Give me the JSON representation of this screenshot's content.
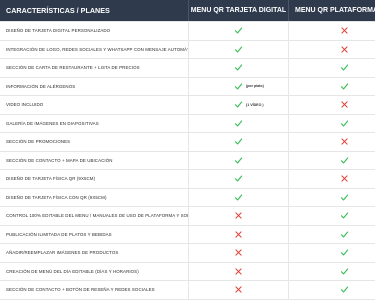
{
  "header": {
    "feature_label": "CARACTERÍSTICAS / PLANES",
    "col1_label": "MENU QR TARJETA DIGITAL",
    "col2_label": "MENU QR PLATAFORMA EDIT"
  },
  "colors": {
    "header_bg": "#2f3b4d",
    "check": "#3cbf5a",
    "cross": "#e0453d"
  },
  "rows": [
    {
      "feature": "DISEÑO DE TARJETA DIGITAL PERSONALIZADO",
      "col1": "check",
      "col1_note": "",
      "col2": "cross"
    },
    {
      "feature": "INTEGRACIÓN DE LOGO, REDES SOCIALES Y WHATSAPP CON MENSAJE AUTOMÁTICO",
      "col1": "check",
      "col1_note": "",
      "col2": "cross"
    },
    {
      "feature": "SECCIÓN DE CARTA DE RESTAURANTE + LISTA DE PRECIOS",
      "col1": "check",
      "col1_note": "",
      "col2": "check"
    },
    {
      "feature": "INFORMACIÓN DE ALÉRGENOS",
      "col1": "check",
      "col1_note": "(por plato)",
      "col2": "check"
    },
    {
      "feature": "VIDEO INCLUIDO",
      "col1": "check",
      "col1_note": "(1 VÍDEO )",
      "col2": "cross"
    },
    {
      "feature": "GALERÍA DE IMÁGENES EN DIAPOSITIVAS",
      "col1": "check",
      "col1_note": "",
      "col2": "check"
    },
    {
      "feature": "SECCIÓN DE PROMOCIONES",
      "col1": "check",
      "col1_note": "",
      "col2": "cross"
    },
    {
      "feature": "SECCIÓN DE CONTACTO + MAPA DE UBICACIÓN",
      "col1": "check",
      "col1_note": "",
      "col2": "check"
    },
    {
      "feature": "DISEÑO DE TARJETA FÍSICA QR (9X5CM)",
      "col1": "check",
      "col1_note": "",
      "col2": "cross"
    },
    {
      "feature": "DISEÑO DE TARJETA FÍSICA CON QR (9X5CM)",
      "col1": "check",
      "col1_note": "",
      "col2": "check"
    },
    {
      "feature": "CONTROL 100% EDITABLE DEL MENU / MANUALES DE USO DE PLATAFORMA Y SOPORTE 24/7",
      "col1": "cross",
      "col1_note": "",
      "col2": "check"
    },
    {
      "feature": "PUBLICACIÓN ILIMITADA DE PLATOS Y BEBIDAS",
      "col1": "cross",
      "col1_note": "",
      "col2": "check"
    },
    {
      "feature": "AÑADIR/REEMPLAZAR IMÁGENES DE PRODUCTOS",
      "col1": "cross",
      "col1_note": "",
      "col2": "check"
    },
    {
      "feature": "CREACIÓN DE MENÚ DEL DÍA EDITABLE (DÍAS Y HORARIOS)",
      "col1": "cross",
      "col1_note": "",
      "col2": "check"
    },
    {
      "feature": "SECCIÓN DE CONTACTO + BOTÓN DE RESEÑA Y REDES SOCIALES",
      "col1": "cross",
      "col1_note": "",
      "col2": "check"
    }
  ]
}
